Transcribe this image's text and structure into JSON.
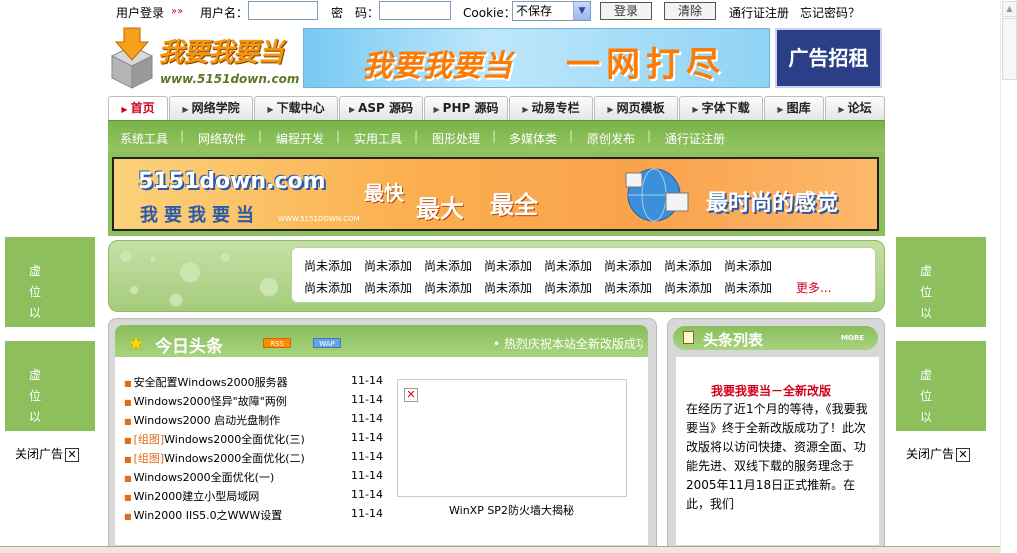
{
  "login": {
    "title": "用户登录",
    "arrows": "»»",
    "username_label": "用户名：",
    "password_label": "密　码：",
    "cookie_label": "Cookie：",
    "cookie_value": "不保存",
    "login_button": "登录",
    "clear_button": "清除",
    "register_link": "通行证注册",
    "forgot_link": "忘记密码？"
  },
  "header": {
    "logo_text": "我要我要当",
    "logo_url": "www.5151down.com",
    "banner_title": "我要我要当",
    "banner_slogan": "一网打尽",
    "ad_rent": "广告招租"
  },
  "nav": {
    "tabs": [
      "首页",
      "网络学院",
      "下载中心",
      "ASP 源码",
      "PHP 源码",
      "动易专栏",
      "网页模板",
      "字体下载",
      "图库",
      "论坛"
    ],
    "subnav": [
      "系统工具",
      "网络软件",
      "编程开发",
      "实用工具",
      "图形处理",
      "多媒体类",
      "原创发布",
      "通行证注册"
    ]
  },
  "main_banner": {
    "site": "5151down.com",
    "sub": "我要我要当",
    "small": "WWW.5151DOWN.COM",
    "w1": "最快",
    "w2": "最大",
    "w3": "最全",
    "w4": "最时尚的感觉"
  },
  "side_ads": {
    "text": "虚位以待",
    "close": "关闭广告",
    "close_icon": "close-x"
  },
  "links": {
    "placeholder": "尚未添加",
    "more": "更多..."
  },
  "today": {
    "title": "今日头条",
    "rss": "RSS",
    "wap": "WAP",
    "ticker": "• 热烈庆祝本站全新改版成功",
    "news": [
      {
        "tag": "",
        "title": "安全配置Windows2000服务器",
        "date": "11-14"
      },
      {
        "tag": "",
        "title": "Windows2000怪异\"故障\"两例",
        "date": "11-14"
      },
      {
        "tag": "",
        "title": "Windows2000 启动光盘制作",
        "date": "11-14"
      },
      {
        "tag": "[组图]",
        "title": "Windows2000全面优化(三)",
        "date": "11-14"
      },
      {
        "tag": "[组图]",
        "title": "Windows2000全面优化(二)",
        "date": "11-14"
      },
      {
        "tag": "",
        "title": "Windows2000全面优化(一)",
        "date": "11-14"
      },
      {
        "tag": "",
        "title": "Win2000建立小型局域网",
        "date": "11-14"
      },
      {
        "tag": "",
        "title": "Win2000 IIS5.0之WWW设置",
        "date": "11-14"
      }
    ],
    "image_caption": "WinXP SP2防火墙大揭秘"
  },
  "headline_list": {
    "title": "头条列表",
    "more": "MORE",
    "heading": "我要我要当－全新改版",
    "paragraph": "在经历了近1个月的等待，《我要我要当》终于全新改版成功了！此次改版将以访问快捷、资源全面、功能先进、双线下载的服务理念于2005年11月18日正式推新。在此，我们"
  },
  "colors": {
    "green": "#8dc05c",
    "red": "#d2001c",
    "orange": "#f7940c"
  }
}
